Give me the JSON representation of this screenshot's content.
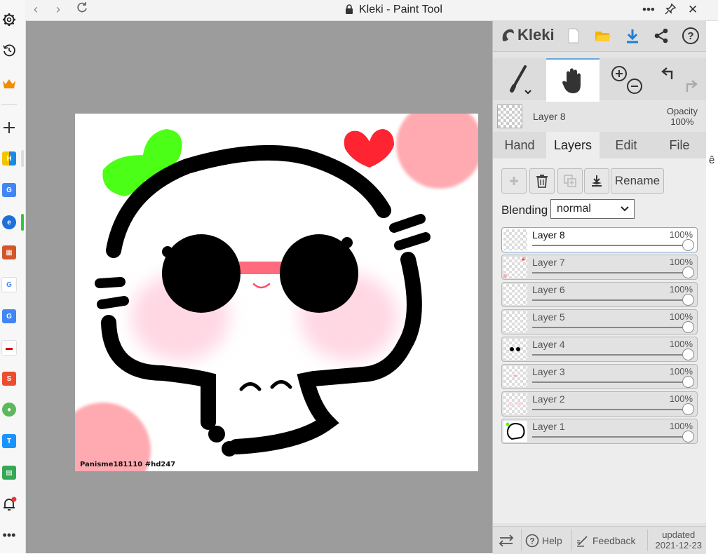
{
  "window": {
    "title": "Kleki - Paint Tool"
  },
  "artwork": {
    "watermark": "Panisme181110 #hd247"
  },
  "panel": {
    "logo_text": "Kleki",
    "current_layer": {
      "name": "Layer 8",
      "opacity_label": "Opacity",
      "opacity_value": "100%"
    },
    "tabs": [
      {
        "label": "Hand",
        "active": false
      },
      {
        "label": "Layers",
        "active": true
      },
      {
        "label": "Edit",
        "active": false
      },
      {
        "label": "File",
        "active": false
      }
    ],
    "layer_actions": {
      "rename_label": "Rename"
    },
    "blending": {
      "label": "Blending",
      "value": "normal"
    },
    "layers": [
      {
        "name": "Layer 8",
        "opacity": "100%",
        "selected": true
      },
      {
        "name": "Layer 7",
        "opacity": "100%",
        "selected": false
      },
      {
        "name": "Layer 6",
        "opacity": "100%",
        "selected": false
      },
      {
        "name": "Layer 5",
        "opacity": "100%",
        "selected": false
      },
      {
        "name": "Layer 4",
        "opacity": "100%",
        "selected": false
      },
      {
        "name": "Layer 3",
        "opacity": "100%",
        "selected": false
      },
      {
        "name": "Layer 2",
        "opacity": "100%",
        "selected": false
      },
      {
        "name": "Layer 1",
        "opacity": "100%",
        "selected": false
      }
    ],
    "footer": {
      "help_label": "Help",
      "feedback_label": "Feedback",
      "updated_label": "updated",
      "updated_date": "2021-12-23"
    }
  },
  "right_edge_text": "ê",
  "colors": {
    "canvas_bg": "#9c9c9c",
    "accent_blue": "#1a7fd6",
    "heart_red": "#ff2431",
    "leaf_green": "#4cff16",
    "blush_pink": "#ffd8e4"
  }
}
